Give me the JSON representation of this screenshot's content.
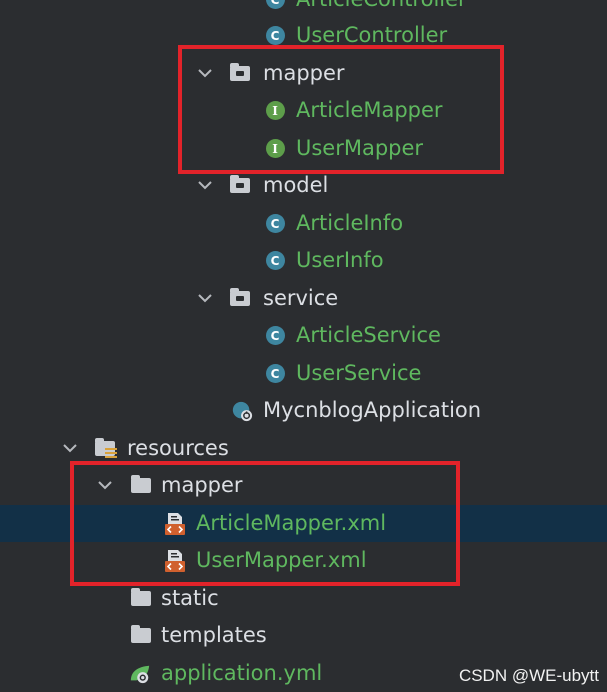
{
  "tree": {
    "controller_items": [
      {
        "label": "ArticleController",
        "icon": "class-icon"
      },
      {
        "label": "UserController",
        "icon": "class-icon"
      }
    ],
    "mapper_pkg": {
      "label": "mapper",
      "items": [
        {
          "label": "ArticleMapper",
          "icon": "interface-icon"
        },
        {
          "label": "UserMapper",
          "icon": "interface-icon"
        }
      ]
    },
    "model_pkg": {
      "label": "model",
      "items": [
        {
          "label": "ArticleInfo",
          "icon": "class-icon"
        },
        {
          "label": "UserInfo",
          "icon": "class-icon"
        }
      ]
    },
    "service_pkg": {
      "label": "service",
      "items": [
        {
          "label": "ArticleService",
          "icon": "class-icon"
        },
        {
          "label": "UserService",
          "icon": "class-icon"
        }
      ]
    },
    "app_class": {
      "label": "MycnblogApplication",
      "icon": "spring-boot-app-icon"
    },
    "resources": {
      "label": "resources",
      "mapper_dir": {
        "label": "mapper",
        "items": [
          {
            "label": "ArticleMapper.xml",
            "icon": "mybatis-xml-icon"
          },
          {
            "label": "UserMapper.xml",
            "icon": "mybatis-xml-icon"
          }
        ]
      },
      "static_dir": {
        "label": "static"
      },
      "templates_dir": {
        "label": "templates"
      },
      "application_yml": {
        "label": "application.yml",
        "icon": "spring-config-icon"
      }
    },
    "class_badge": "C",
    "interface_badge": "I"
  },
  "watermark": "CSDN @WE-ubytt",
  "colors": {
    "background": "#2b2d30",
    "selected_row": "#123047",
    "file_text": "#5fb85f",
    "folder_text": "#dcdfe4",
    "highlight_box": "#e2232a"
  }
}
